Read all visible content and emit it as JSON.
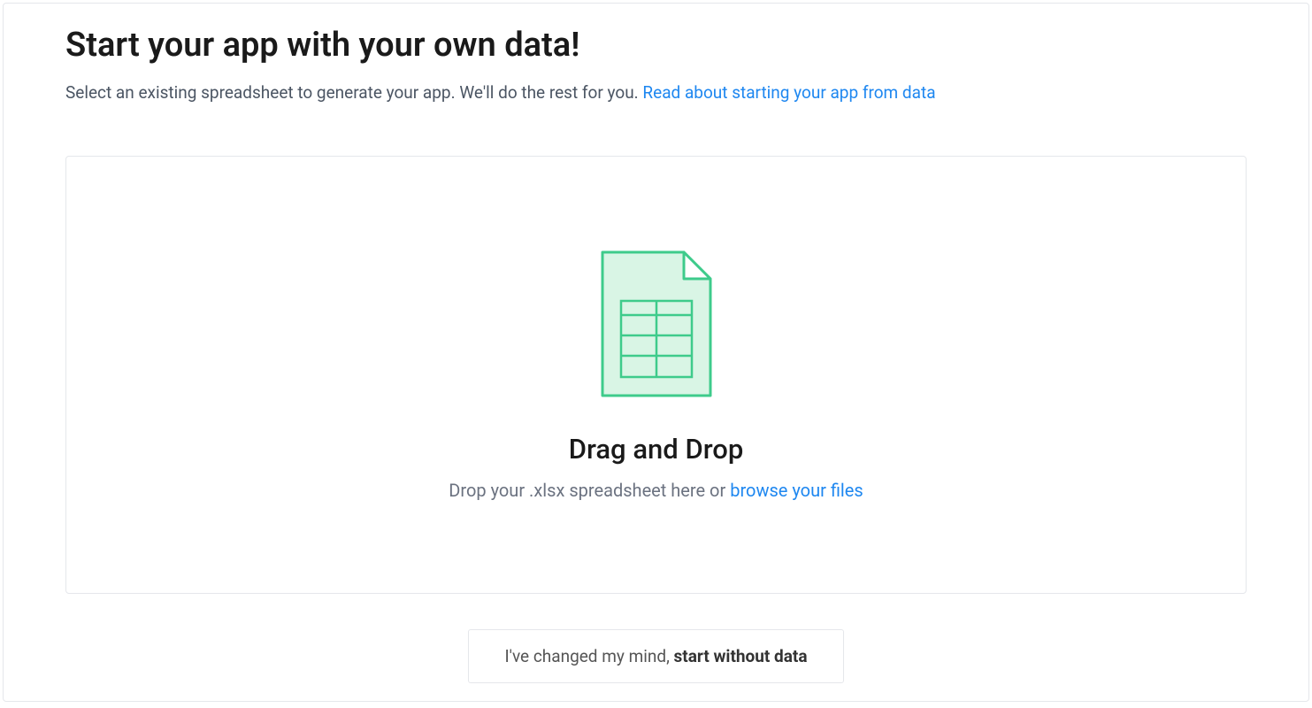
{
  "header": {
    "title": "Start your app with your own data!",
    "subtitle_text": "Select an existing spreadsheet to generate your app. We'll do the rest for you. ",
    "subtitle_link": "Read about starting your app from data"
  },
  "dropzone": {
    "title": "Drag and Drop",
    "instruction_text": "Drop your .xlsx spreadsheet here or ",
    "browse_link": "browse your files"
  },
  "skip": {
    "prefix": "I've changed my mind, ",
    "bold": "start without data"
  },
  "icon": {
    "name": "spreadsheet-file-icon"
  }
}
